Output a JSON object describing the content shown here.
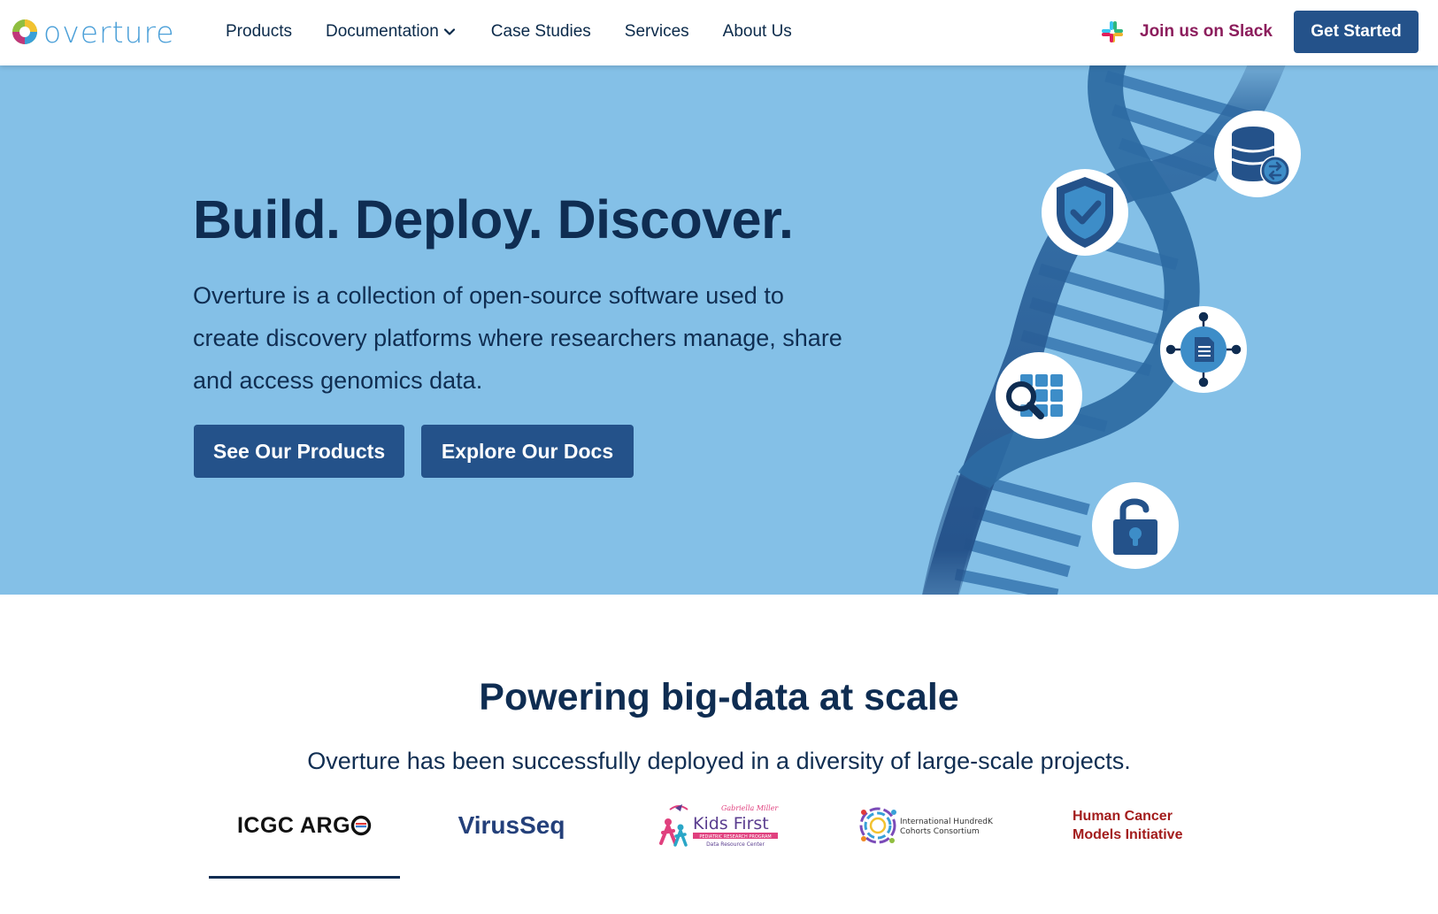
{
  "nav": {
    "logo_text": "overture",
    "links": [
      {
        "label": "Products"
      },
      {
        "label": "Documentation"
      },
      {
        "label": "Case Studies"
      },
      {
        "label": "Services"
      },
      {
        "label": "About Us"
      }
    ],
    "slack_label": "Join us on Slack",
    "cta_label": "Get Started"
  },
  "hero": {
    "title": "Build. Deploy. Discover.",
    "text": "Overture is a collection of open-source software used to create discovery platforms where researchers manage, share and access genomics data.",
    "button_products": "See Our Products",
    "button_docs": "Explore Our Docs",
    "icons": [
      "database-exchange-icon",
      "shield-check-icon",
      "document-hub-icon",
      "search-grid-icon",
      "unlock-icon"
    ]
  },
  "power": {
    "title": "Powering big-data at scale",
    "subtitle": "Overture has been successfully deployed in a diversity of large-scale projects."
  },
  "partners": {
    "argo": "ICGC ARG",
    "virusseq": "VirusSeq",
    "kidsfirst": {
      "top": "Gabriella Miller",
      "main": "Kids First",
      "band": "PEDIATRIC RESEARCH PROGRAM",
      "sub": "Data Resource Center"
    },
    "hundredk": {
      "line1": "International HundredK+",
      "line2": "Cohorts Consortium"
    },
    "hcmi": {
      "line1": "Human Cancer",
      "line2": "Models Initiative"
    }
  },
  "colors": {
    "navy": "#0f2d52",
    "button_blue": "#24528a",
    "hero_bg": "#84c0e7",
    "slack_text": "#8c1d5c",
    "logo_blue": "#4a9fd8",
    "hcmi_red": "#a31c1c"
  }
}
